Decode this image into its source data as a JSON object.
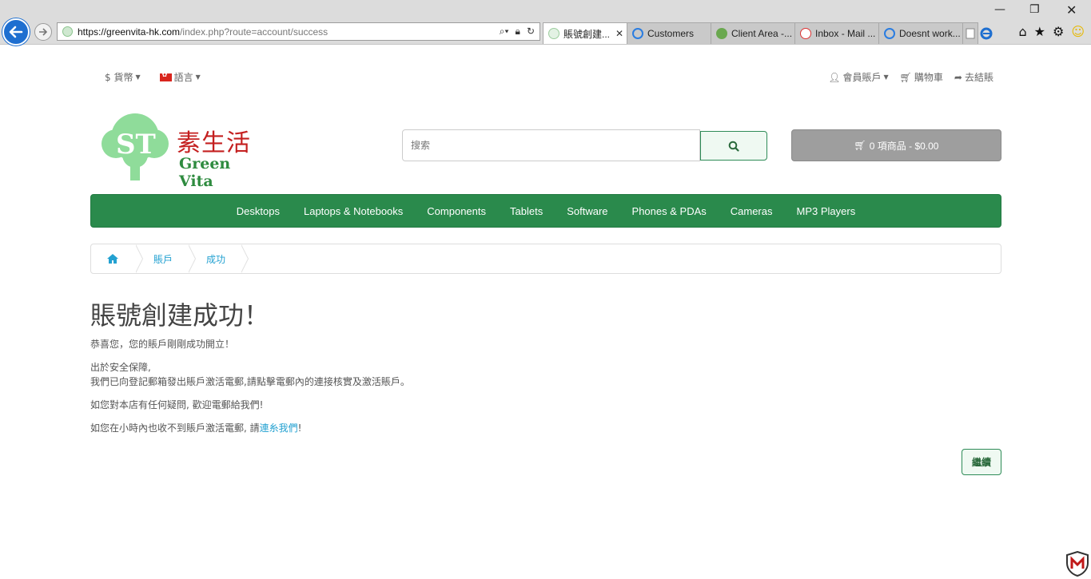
{
  "browser": {
    "url_domain": "https://greenvita-hk.com",
    "url_path": "/index.php?route=account/success",
    "tabs": [
      {
        "label": "賬號創建...",
        "active": true,
        "close": "✕"
      },
      {
        "label": "Customers",
        "active": false
      },
      {
        "label": "Client Area -...",
        "active": false
      },
      {
        "label": "Inbox - Mail ...",
        "active": false
      },
      {
        "label": "Doesnt work...",
        "active": false
      }
    ],
    "window_controls": {
      "minimize": "—",
      "restore": "❐",
      "close": "✕"
    }
  },
  "topbar": {
    "currency": "$ 貨幣",
    "language": "語言",
    "account": "會員賬戶",
    "cart": "購物車",
    "checkout": "去結賬"
  },
  "logo": {
    "cn": "素生活",
    "en": "Green Vita"
  },
  "search": {
    "placeholder": "搜索"
  },
  "cart_button": {
    "label": "0 項商品 - $0.00"
  },
  "menu": [
    "Desktops",
    "Laptops & Notebooks",
    "Components",
    "Tablets",
    "Software",
    "Phones & PDAs",
    "Cameras",
    "MP3 Players"
  ],
  "breadcrumb": {
    "account": "賬戶",
    "success": "成功"
  },
  "main": {
    "title": "賬號創建成功！",
    "p1": "恭喜您，您的賬戶剛剛成功開立！",
    "p2a": "出於安全保障,",
    "p2b": "我們已向登記郵箱發出賬戶激活電郵,請點擊電郵內的連接核實及激活賬戶。",
    "p3": "如您對本店有任何疑問, 歡迎電郵給我們!",
    "p4a": "如您在小時內也收不到賬戶激活電郵, 請",
    "p4link": "連糸我們",
    "p4b": "!",
    "continue": "繼續"
  },
  "colors": {
    "menu_bg": "#2a8a4c",
    "link": "#23a1d1",
    "cart_bg": "#9e9e9e"
  }
}
